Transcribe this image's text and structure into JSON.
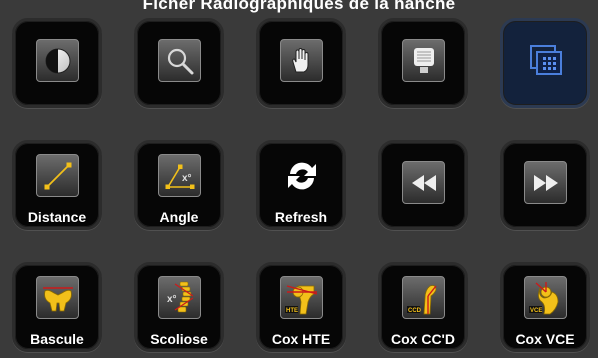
{
  "header": {
    "title": "Ficher Radiographiques de la hanche"
  },
  "tools": [
    {
      "label": "",
      "icon": "contrast-icon"
    },
    {
      "label": "",
      "icon": "magnifier-icon"
    },
    {
      "label": "",
      "icon": "hand-pan-icon"
    },
    {
      "label": "",
      "icon": "window-level-icon"
    },
    {
      "label": "",
      "icon": "multi-window-grid-icon",
      "state": "active"
    },
    {
      "label": "Distance",
      "icon": "distance-ruler-icon"
    },
    {
      "label": "Angle",
      "icon": "angle-measure-icon"
    },
    {
      "label": "Refresh",
      "icon": "refresh-icon"
    },
    {
      "label": "",
      "icon": "rewind-icon"
    },
    {
      "label": "",
      "icon": "fast-forward-icon"
    },
    {
      "label": "Bascule",
      "icon": "pelvis-icon"
    },
    {
      "label": "Scoliose",
      "icon": "spine-icon"
    },
    {
      "label": "Cox HTE",
      "icon": "hip-hte-icon"
    },
    {
      "label": "Cox CC'D",
      "icon": "hip-ccd-icon"
    },
    {
      "label": "Cox VCE",
      "icon": "hip-vce-icon"
    }
  ],
  "colors": {
    "background": "#3a3a3a",
    "tile": "#060606",
    "tile_active": "#13223c",
    "accent_yellow": "#f2c01a",
    "accent_red": "#cc1a1a"
  }
}
